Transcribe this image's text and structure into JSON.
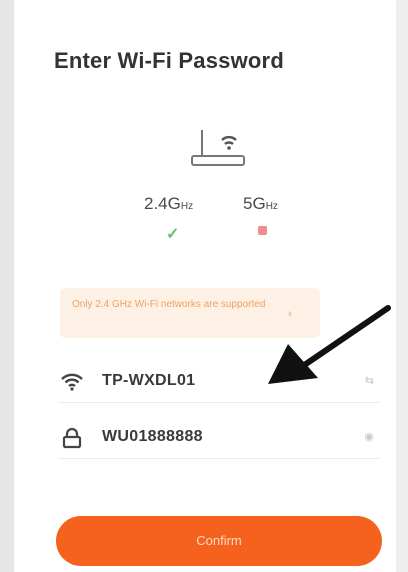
{
  "header": {
    "title": "Enter Wi-Fi Password"
  },
  "bands": {
    "band_24": "2.4G",
    "band_24_unit": "Hz",
    "band_5": "5G",
    "band_5_unit": "Hz"
  },
  "notice": {
    "text": "Only 2.4 GHz Wi-Fi networks are supported"
  },
  "fields": {
    "ssid_value": "TP-WXDL01",
    "password_value": "WU01888888"
  },
  "actions": {
    "confirm_label": "Confirm"
  },
  "colors": {
    "accent": "#f5621e",
    "supported": "#6ac26e",
    "unsupported": "#f08c8c",
    "notice_bg": "#fdf1e6"
  },
  "icons": [
    "router-icon",
    "check-icon",
    "x-icon",
    "wifi-icon",
    "lock-icon",
    "eye-icon",
    "arrow-icon"
  ]
}
